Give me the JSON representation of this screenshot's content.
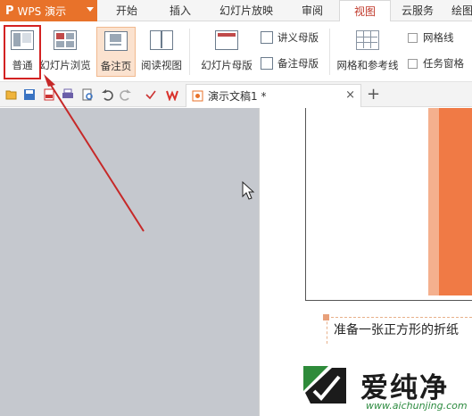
{
  "app": {
    "logo": "P",
    "name": "WPS 演示"
  },
  "tabs": [
    {
      "label": "开始",
      "active": false
    },
    {
      "label": "插入",
      "active": false
    },
    {
      "label": "幻灯片放映",
      "active": false
    },
    {
      "label": "审阅",
      "active": false
    },
    {
      "label": "视图",
      "active": true
    },
    {
      "label": "云服务",
      "active": false
    },
    {
      "label": "绘图",
      "active": false
    }
  ],
  "ribbon": {
    "normal": "普通",
    "slide_sorter": "幻灯片浏览",
    "notes_page": "备注页",
    "reading_view": "阅读视图",
    "slide_master": "幻灯片母版",
    "handout_master": "讲义母版",
    "notes_master": "备注母版",
    "grid_guides": "网格和参考线",
    "gridlines": "网格线",
    "task_pane": "任务窗格"
  },
  "document": {
    "tab_title": "演示文稿1 *",
    "close": "×",
    "add": "+"
  },
  "notes": {
    "text": "准备一张正方形的折纸"
  },
  "watermark": {
    "text": "爱纯净",
    "url": "www.aichunjing.com"
  },
  "colors": {
    "accent": "#e8722a",
    "highlight": "#d32222",
    "slide_orange": "#f07a45"
  }
}
